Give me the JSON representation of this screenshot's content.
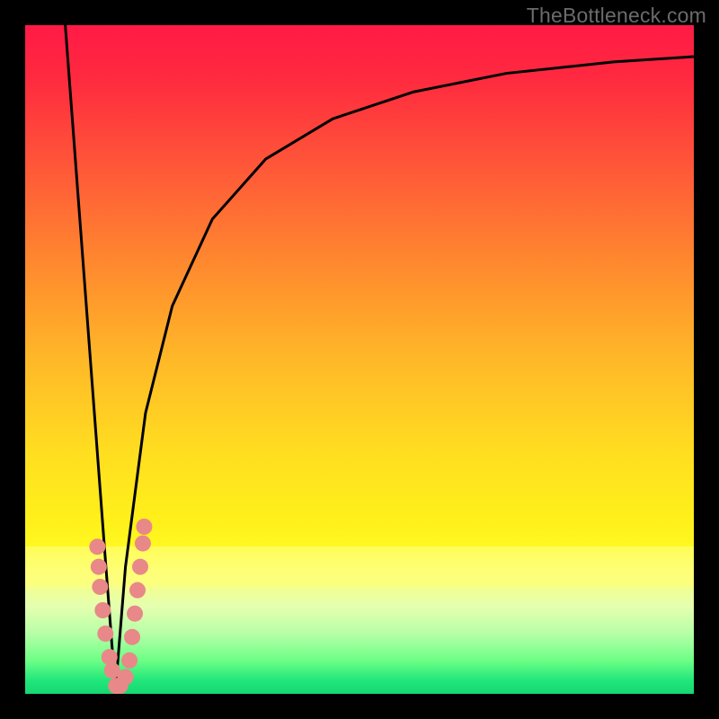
{
  "watermark": "TheBottleneck.com",
  "chart_data": {
    "type": "line",
    "title": "",
    "xlabel": "",
    "ylabel": "",
    "xlim": [
      0,
      1
    ],
    "ylim": [
      0,
      1
    ],
    "notes": "Unlabeled bottleneck-style V-curve overlaid on vertical spectral gradient (red top → green bottom). Minimum at x≈0.135 where left-descending and right-ascending curves meet near y≈0. No axis ticks or numeric labels present.",
    "series": [
      {
        "name": "left-branch",
        "x": [
          0.06,
          0.075,
          0.09,
          0.105,
          0.12,
          0.135
        ],
        "y": [
          1.0,
          0.8,
          0.6,
          0.4,
          0.2,
          0.005
        ]
      },
      {
        "name": "right-branch",
        "x": [
          0.135,
          0.15,
          0.18,
          0.22,
          0.28,
          0.36,
          0.46,
          0.58,
          0.72,
          0.88,
          1.0
        ],
        "y": [
          0.005,
          0.19,
          0.42,
          0.58,
          0.71,
          0.8,
          0.86,
          0.9,
          0.928,
          0.945,
          0.953
        ]
      }
    ],
    "markers": {
      "name": "cluster-points",
      "color": "#e98888",
      "radius_px": 9,
      "x": [
        0.108,
        0.11,
        0.112,
        0.116,
        0.12,
        0.126,
        0.13,
        0.136,
        0.142,
        0.15,
        0.156,
        0.16,
        0.164,
        0.168,
        0.172,
        0.176,
        0.178
      ],
      "y": [
        0.22,
        0.19,
        0.16,
        0.125,
        0.09,
        0.055,
        0.035,
        0.012,
        0.012,
        0.025,
        0.05,
        0.085,
        0.12,
        0.155,
        0.19,
        0.225,
        0.25
      ]
    }
  }
}
